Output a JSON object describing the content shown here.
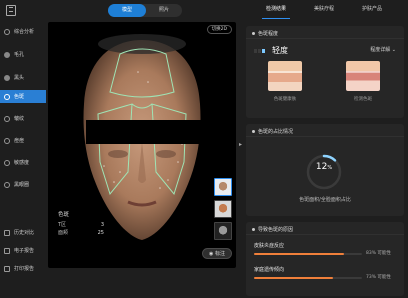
{
  "view_tabs": [
    "模型",
    "照片"
  ],
  "right_tabs": [
    "检测结果",
    "美肤疗程",
    "护肤产品"
  ],
  "sidebar": {
    "items": [
      {
        "label": "综合分析",
        "icon": "analysis-icon"
      },
      {
        "label": "毛孔",
        "icon": "pore-icon"
      },
      {
        "label": "黑头",
        "icon": "blackhead-icon"
      },
      {
        "label": "色斑",
        "icon": "spot-icon",
        "active": true
      },
      {
        "label": "皱纹",
        "icon": "wrinkle-icon"
      },
      {
        "label": "痘痘",
        "icon": "acne-icon"
      },
      {
        "label": "敏感度",
        "icon": "sensitivity-icon"
      },
      {
        "label": "黑眼圈",
        "icon": "dark-circle-icon"
      }
    ],
    "tools": [
      {
        "label": "历史对比",
        "icon": "compare-icon"
      },
      {
        "label": "电子报告",
        "icon": "report-icon"
      },
      {
        "label": "打印报告",
        "icon": "print-icon"
      }
    ]
  },
  "photo": {
    "switch_label": "切换2D",
    "legend_title": "色斑",
    "legend_rows": [
      {
        "label": "T区",
        "value": "3"
      },
      {
        "label": "面颊",
        "value": "25"
      }
    ],
    "annotate_label": "标注"
  },
  "card1": {
    "title": "色斑程度",
    "level": "轻度",
    "level_bar": 3,
    "select_label": "程度详解",
    "images": [
      {
        "caption": "色斑健康肤"
      },
      {
        "caption": "检测色斑"
      }
    ]
  },
  "card2": {
    "title": "色斑的占比情况",
    "percent": 12,
    "percent_text": "12",
    "percent_unit": "%",
    "caption": "色斑面积/全脸面积占比"
  },
  "card3": {
    "title": "导致色斑的原因",
    "causes": [
      {
        "name": "皮肤炎症反应",
        "value": 83,
        "text": "83% 可能性"
      },
      {
        "name": "家庭遗传倾向",
        "value": 73,
        "text": "73% 可能性"
      }
    ]
  },
  "colors": {
    "accent": "#2a7fd4",
    "ring": "#8ed3ff",
    "cause_bar": "#ef7f3a",
    "outline": "#9fe4b5"
  }
}
